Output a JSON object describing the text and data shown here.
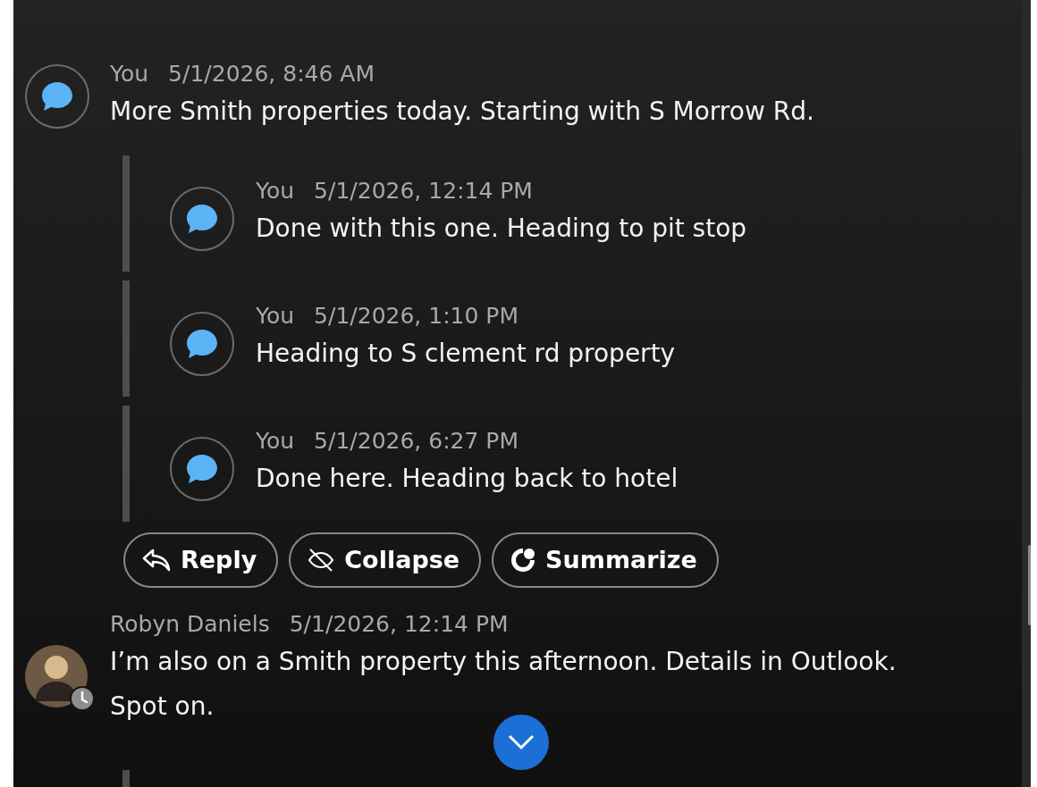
{
  "thread": {
    "message": {
      "author": "You",
      "time": "5/1/2026, 8:46 AM",
      "text": "More Smith properties today. Starting with S Morrow Rd.",
      "kind": "bubble"
    },
    "replies": [
      {
        "author": "You",
        "time": "5/1/2026, 12:14 PM",
        "text": "Done with this one. Heading to pit stop",
        "kind": "bubble"
      },
      {
        "author": "You",
        "time": "5/1/2026, 1:10 PM",
        "text": "Heading to S clement rd property",
        "kind": "bubble"
      },
      {
        "author": "You",
        "time": "5/1/2026, 6:27 PM",
        "text": "Done here. Heading back to hotel",
        "kind": "bubble"
      }
    ],
    "actions": [
      {
        "label": "Reply",
        "kind": "reply"
      },
      {
        "label": "Collapse",
        "kind": "collapse"
      },
      {
        "label": "Summarize",
        "kind": "summarize"
      }
    ]
  },
  "next_message": {
    "author": "Robyn Daniels",
    "time": "5/1/2026, 12:14 PM",
    "text": "I’m also on a Smith property this afternoon. Details in Outlook. Spot on.",
    "kind": "photo",
    "away": true
  }
}
